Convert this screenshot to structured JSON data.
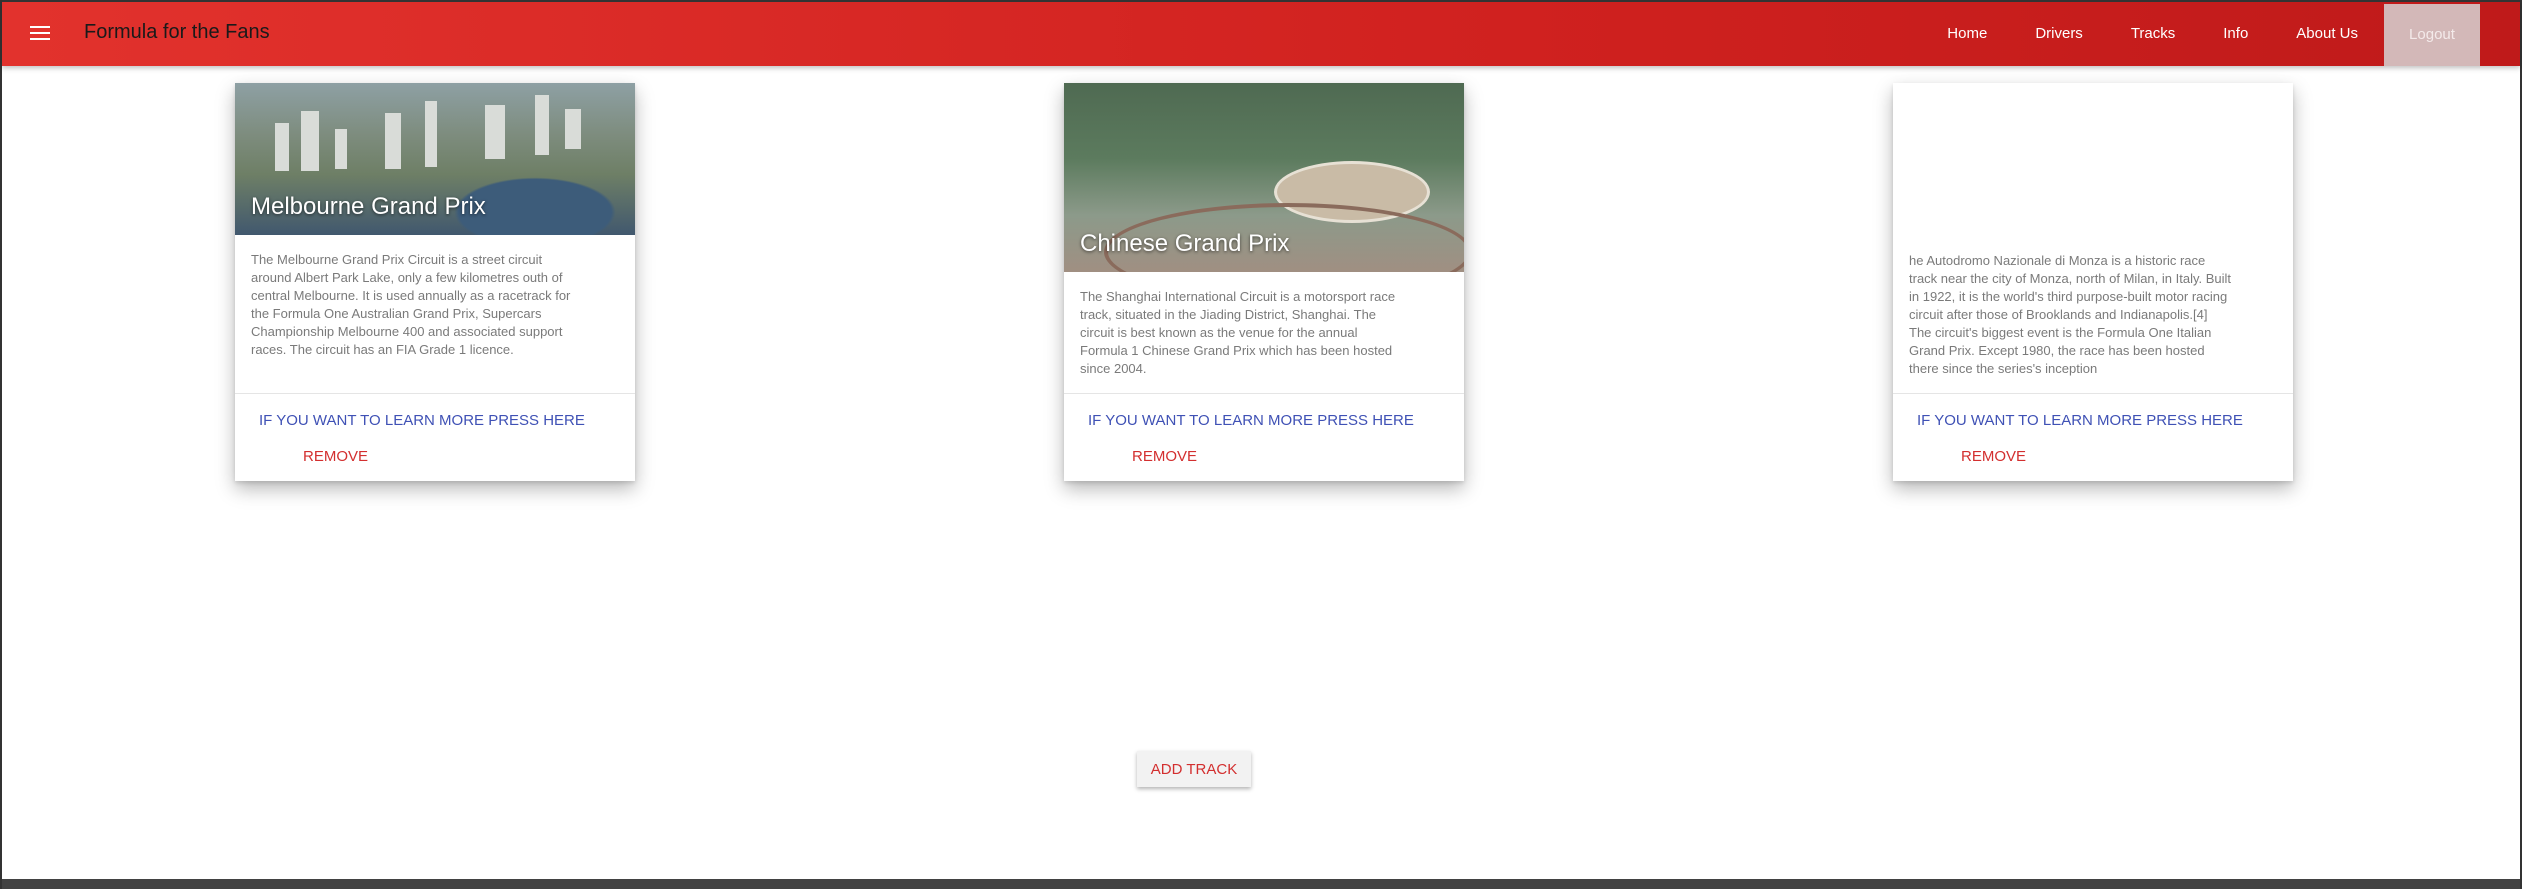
{
  "header": {
    "brand": "Formula for the Fans",
    "nav": [
      "Home",
      "Drivers",
      "Tracks",
      "Info",
      "About Us",
      "Logout"
    ]
  },
  "cards": [
    {
      "title": "Melbourne Grand Prix",
      "text": "The Melbourne Grand Prix Circuit is a street circuit around Albert Park Lake, only a few kilometres outh of central Melbourne. It is used annually as a racetrack for the Formula One Australian Grand Prix, Supercars Championship Melbourne 400 and associated support races. The circuit has an FIA Grade 1 licence.",
      "learn": "IF YOU WANT TO LEARN MORE PRESS HERE",
      "remove": "REMOVE"
    },
    {
      "title": "Chinese Grand Prix",
      "text": "The Shanghai International Circuit is a motorsport race track, situated in the Jiading District, Shanghai. The circuit is best known as the venue for the annual Formula 1 Chinese Grand Prix which has been hosted since 2004.",
      "learn": "IF YOU WANT TO LEARN MORE PRESS HERE",
      "remove": "REMOVE"
    },
    {
      "title": "",
      "text": "he Autodromo Nazionale di Monza is a historic race track near the city of Monza, north of Milan, in Italy. Built in 1922, it is the world's third purpose-built motor racing circuit after those of Brooklands and Indianapolis.[4] The circuit's biggest event is the Formula One Italian Grand Prix. Except 1980, the race has been hosted there since the series's inception",
      "learn": "IF YOU WANT TO LEARN MORE PRESS HERE",
      "remove": "REMOVE"
    }
  ],
  "add_track": "ADD TRACK"
}
